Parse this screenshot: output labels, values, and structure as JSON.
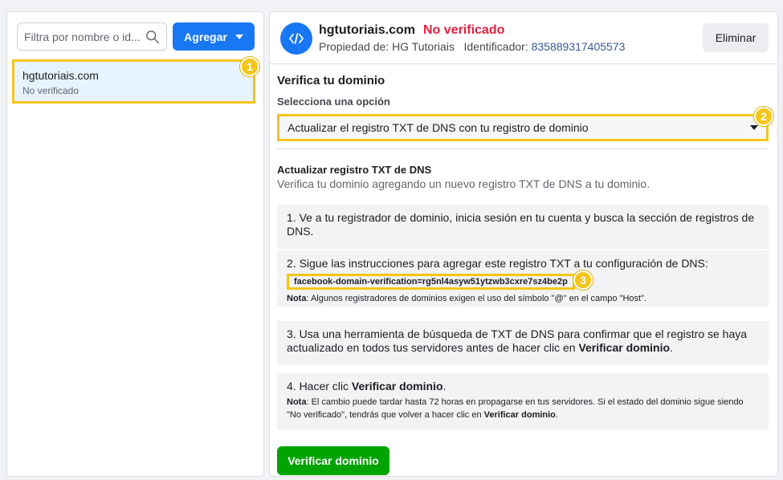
{
  "sidebar": {
    "search_placeholder": "Filtra por nombre o id...",
    "add_label": "Agregar",
    "domain": {
      "name": "hgtutoriais.com",
      "status": "No verificado"
    },
    "badge": "1"
  },
  "header": {
    "title": "hgtutoriais.com",
    "status": "No verificado",
    "owner_label": "Propiedad de: HG Tutoriais",
    "id_label": "Identificador:",
    "id_value": "835889317405573",
    "delete_label": "Eliminar"
  },
  "main": {
    "verify_title": "Verifica tu dominio",
    "select_label": "Selecciona una opción",
    "dropdown_value": "Actualizar el registro TXT de DNS con tu registro de dominio",
    "dropdown_badge": "2",
    "update_title": "Actualizar registro TXT de DNS",
    "update_desc": "Verifica tu dominio agregando un nuevo registro TXT de DNS a tu dominio.",
    "steps": [
      {
        "text": "1. Ve a tu registrador de dominio, inicia sesión en tu cuenta y busca la sección de registros de DNS."
      },
      {
        "text": "2. Sigue las instrucciones para agregar este registro TXT a tu configuración de DNS:",
        "code": "facebook-domain-verification=rg5nl4asyw51ytzwb3cxre7sz4be2p",
        "code_badge": "3",
        "note_label": "Nota",
        "note_text": ": Algunos registradores de dominios exigen el uso del símbolo \"@\" en el campo \"Host\"."
      },
      {
        "text_before": "3. Usa una herramienta de búsqueda de TXT de DNS para confirmar que el registro se haya actualizado en todos tus servidores antes de hacer clic en ",
        "text_bold": "Verificar dominio",
        "text_after": "."
      },
      {
        "text_before": "4. Hacer clic ",
        "text_bold": "Verificar dominio",
        "text_after": ".",
        "note_label": "Nota",
        "note_text": ": El cambio puede tardar hasta 72 horas en propagarse en tus servidores. Si el estado del dominio sigue siendo \"No verificado\", tendrás que volver a hacer clic en ",
        "note_bold": "Verificar dominio",
        "note_end": "."
      }
    ],
    "verify_button": "Verificar dominio"
  },
  "colors": {
    "accent": "#1877f2",
    "danger": "#e41e3f",
    "success": "#00a400",
    "highlight": "#f5c518"
  },
  "icons": [
    "search-icon",
    "caret-down-icon",
    "code-icon"
  ]
}
